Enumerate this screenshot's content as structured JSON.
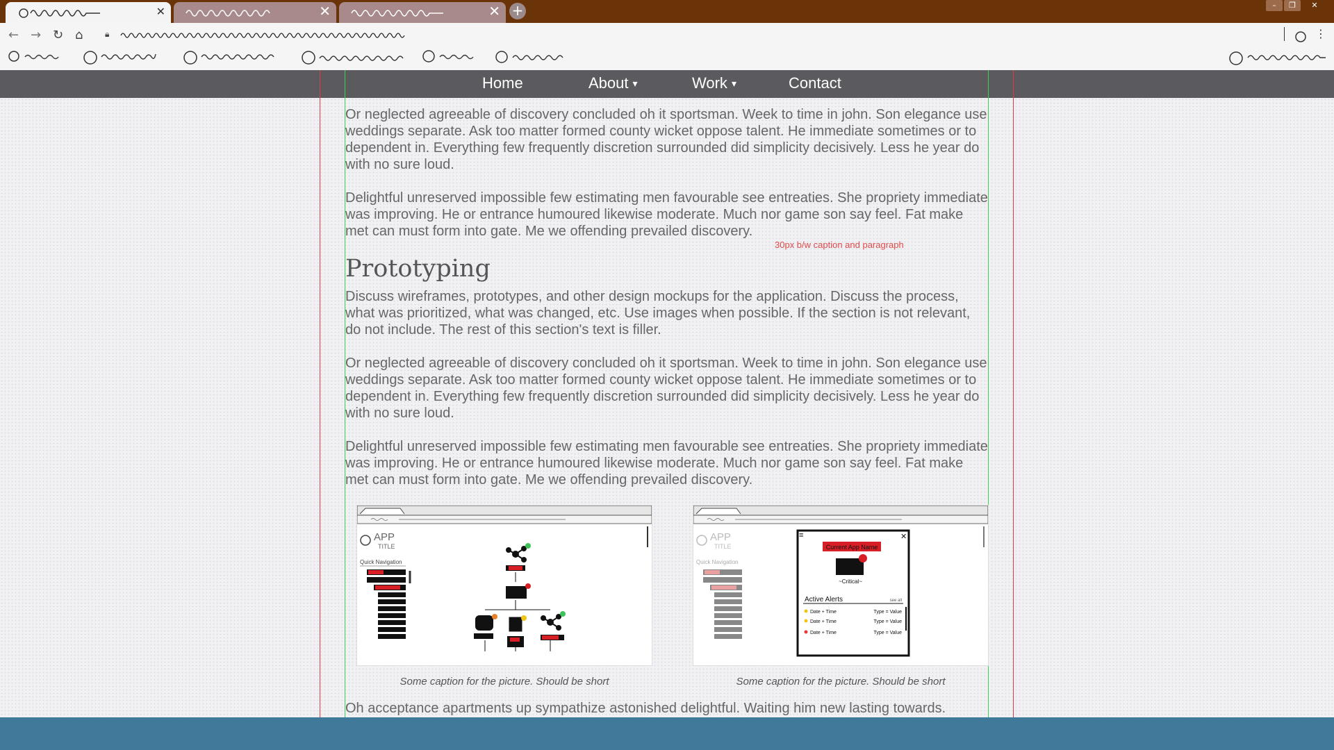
{
  "browser": {
    "tabs": [
      {
        "state": "active",
        "label_icon": "scribble-text"
      },
      {
        "state": "inactive",
        "label_icon": "scribble-text"
      },
      {
        "state": "inactive",
        "label_icon": "scribble-text"
      }
    ],
    "new_tab_label": "+",
    "window_controls": [
      "minimize",
      "restore",
      "close"
    ],
    "nav_icons": [
      "back-arrow-icon",
      "forward-arrow-icon",
      "reload-icon",
      "home-icon",
      "lock-icon"
    ],
    "bookmark_count": 6
  },
  "site_nav": {
    "items": [
      {
        "label": "Home",
        "has_dropdown": false
      },
      {
        "label": "About",
        "has_dropdown": true
      },
      {
        "label": "Work",
        "has_dropdown": true
      },
      {
        "label": "Contact",
        "has_dropdown": false
      }
    ],
    "caret": "▾"
  },
  "content": {
    "p1": "Or neglected agreeable of discovery concluded oh it sportsman. Week to time in john. Son elegance use weddings separate. Ask too matter formed county wicket oppose talent. He immediate sometimes or to dependent in. Everything few frequently discretion surrounded did simplicity decisively. Less he year do with no sure loud.",
    "p2": "Delightful unreserved impossible few estimating men favourable see entreaties. She propriety immediate was improving. He or entrance humoured likewise moderate. Much nor game son say feel. Fat make met can must form into gate. Me we offending prevailed discovery.",
    "annotation": "30px b/w caption and paragraph",
    "heading": "Prototyping",
    "p3": "Discuss wireframes, prototypes, and other design mockups for the application. Discuss the process, what was prioritized, what was changed, etc. Use images when possible. If the section is not relevant, do not include. The rest of this section's text is filler.",
    "p4": "Or neglected agreeable of discovery concluded oh it sportsman. Week to time in john. Son elegance use weddings separate. Ask too matter formed county wicket oppose talent. He immediate sometimes or to dependent in. Everything few frequently discretion surrounded did simplicity decisively. Less he year do with no sure loud.",
    "p5": "Delightful unreserved impossible few estimating men favourable see entreaties. She propriety immediate was improving. He or entrance humoured likewise moderate. Much nor game son say feel. Fat make met can must form into gate. Me we offending prevailed discovery.",
    "figures": [
      {
        "caption": "Some caption for the picture. Should be short",
        "mock": {
          "app_title_1": "APP",
          "app_title_2": "TITLE",
          "nav_label": "Quick Navigation"
        }
      },
      {
        "caption": "Some caption for the picture. Should be short",
        "mock": {
          "app_title_1": "APP",
          "app_title_2": "TITLE",
          "nav_label": "Quick Navigation",
          "modal_title": "Current App Name",
          "modal_status": "~Critical~",
          "alerts_heading": "Active Alerts",
          "alerts_link": "see all",
          "alert_rows": [
            {
              "left": "Date + Time",
              "right": "Type = Value",
              "dot": "#f0c419"
            },
            {
              "left": "Date + Time",
              "right": "Type = Value",
              "dot": "#f0c419"
            },
            {
              "left": "Date + Time",
              "right": "Type = Value",
              "dot": "#e23b3b"
            }
          ]
        }
      }
    ],
    "p6": "Oh acceptance apartments up sympathize astonished delightful. Waiting him new lasting towards."
  },
  "colors": {
    "titlebar": "#6b3308",
    "site_nav": "#5b5b5f",
    "guide_red": "#e23b3b",
    "guide_green": "#3ed14c",
    "bottom_bar": "#3f7a9b",
    "mock_red": "#d81f26"
  }
}
